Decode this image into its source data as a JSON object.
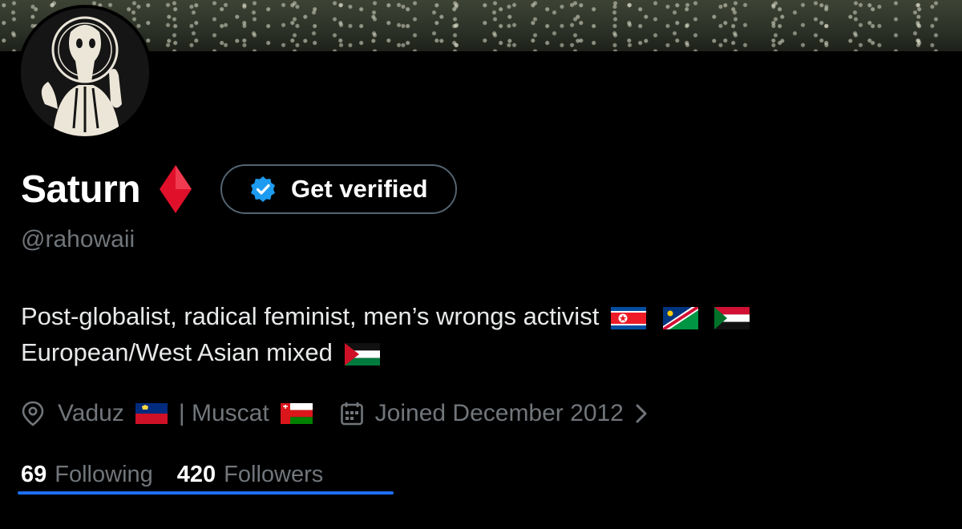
{
  "profile": {
    "display_name": "Saturn",
    "name_emoji_icon": "red-diamond-icon",
    "handle": "@rahowaii",
    "get_verified_label": "Get verified",
    "bio_line1": "Post-globalist, radical feminist, men’s wrongs activist",
    "bio_line1_flags": [
      "north-korea-flag-icon",
      "namibia-flag-icon",
      "sudan-flag-icon"
    ],
    "bio_line2": "European/West Asian mixed",
    "bio_line2_flags": [
      "palestine-flag-icon"
    ],
    "location_a": "Vaduz",
    "location_a_flag": "liechtenstein-flag-icon",
    "location_sep": "| Muscat",
    "location_b_flag": "oman-flag-icon",
    "joined": "Joined December 2012",
    "following_count": "69",
    "following_label": "Following",
    "followers_count": "420",
    "followers_label": "Followers"
  },
  "colors": {
    "background": "#000000",
    "muted_text": "#71767b",
    "verified_blue": "#1d9bf0",
    "underline_blue": "#1d6ff2",
    "diamond_red": "#e0102b"
  }
}
